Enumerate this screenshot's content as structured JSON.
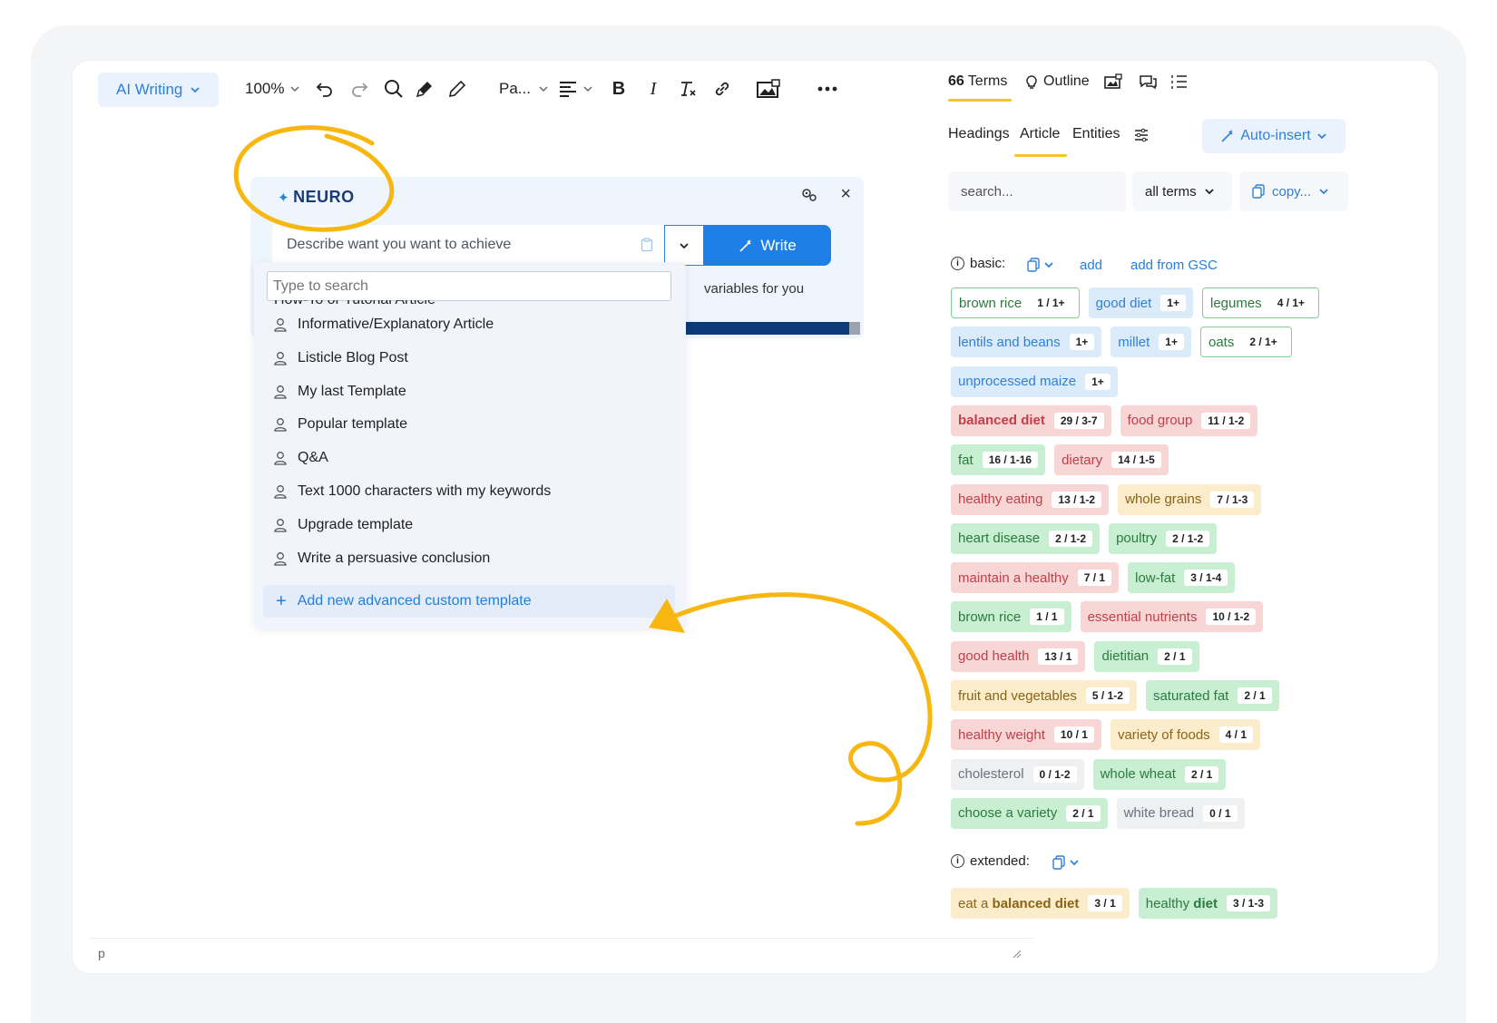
{
  "toolbar": {
    "ai_writing_label": "AI Writing",
    "zoom_label": "100%",
    "paragraph_label": "Pa..."
  },
  "editor": {
    "footer_tag": "p"
  },
  "neuro": {
    "logo_text": "NEURO",
    "prompt_placeholder": "Describe want you want to achieve",
    "write_label": "Write",
    "variables_text": "variables for you"
  },
  "dropdown": {
    "search_placeholder": "Type to search",
    "clipped_item": "How-To or Tutorial Article",
    "items": [
      "Informative/Explanatory Article",
      "Listicle Blog Post",
      "My last Template",
      "Popular template",
      "Q&A",
      "Text 1000 characters with my keywords",
      "Upgrade template",
      "Write a persuasive conclusion"
    ],
    "add_label": "Add new advanced custom template"
  },
  "right_panel": {
    "tabs": {
      "terms": "Terms",
      "outline": "Outline"
    },
    "sub_tabs": {
      "headings": "Headings",
      "article": "Article",
      "entities": "Entities"
    },
    "auto_insert_label": "Auto-insert",
    "search_placeholder": "search...",
    "filter_label": "all terms",
    "copy_label": "copy...",
    "basic_label": "basic:",
    "add_label": "add",
    "add_gsc_label": "add from GSC",
    "extended_label": "extended:"
  },
  "terms": [
    [
      {
        "text": "brown rice",
        "count": "1 / 1+",
        "style": "green-o"
      },
      {
        "text": "good diet",
        "count": "1+",
        "style": "blue"
      },
      {
        "text": "legumes",
        "count": "4 / 1+",
        "style": "green-o"
      }
    ],
    [
      {
        "text": "lentils and beans",
        "count": "1+",
        "style": "blue"
      },
      {
        "text": "millet",
        "count": "1+",
        "style": "blue"
      },
      {
        "text": "oats",
        "count": "2 / 1+",
        "style": "green-o"
      }
    ],
    [
      {
        "text": "unprocessed maize",
        "count": "1+",
        "style": "blue"
      }
    ],
    [
      {
        "text": "balanced diet",
        "count": "29 / 3-7",
        "style": "red-b"
      },
      {
        "text": "food group",
        "count": "11 / 1-2",
        "style": "red"
      }
    ],
    [
      {
        "text": "fat",
        "count": "16 / 1-16",
        "style": "green"
      },
      {
        "text": "dietary",
        "count": "14 / 1-5",
        "style": "red"
      }
    ],
    [
      {
        "text": "healthy eating",
        "count": "13 / 1-2",
        "style": "red"
      },
      {
        "text": "whole grains",
        "count": "7 / 1-3",
        "style": "yellow"
      }
    ],
    [
      {
        "text": "heart disease",
        "count": "2 / 1-2",
        "style": "green"
      },
      {
        "text": "poultry",
        "count": "2 / 1-2",
        "style": "green"
      }
    ],
    [
      {
        "text": "maintain a healthy",
        "count": "7 / 1",
        "style": "red"
      },
      {
        "text": "low-fat",
        "count": "3 / 1-4",
        "style": "green"
      }
    ],
    [
      {
        "text": "brown rice",
        "count": "1 / 1",
        "style": "green"
      },
      {
        "text": "essential nutrients",
        "count": "10 / 1-2",
        "style": "red"
      }
    ],
    [
      {
        "text": "good health",
        "count": "13 / 1",
        "style": "red"
      },
      {
        "text": "dietitian",
        "count": "2 / 1",
        "style": "green"
      }
    ],
    [
      {
        "text": "fruit and vegetables",
        "count": "5 / 1-2",
        "style": "yellow"
      },
      {
        "text": "saturated fat",
        "count": "2 / 1",
        "style": "green"
      }
    ],
    [
      {
        "text": "healthy weight",
        "count": "10 / 1",
        "style": "red"
      },
      {
        "text": "variety of foods",
        "count": "4 / 1",
        "style": "yellow"
      }
    ],
    [
      {
        "text": "cholesterol",
        "count": "0 / 1-2",
        "style": "gray"
      },
      {
        "text": "whole wheat",
        "count": "2 / 1",
        "style": "green"
      }
    ],
    [
      {
        "text": "choose a variety",
        "count": "2 / 1",
        "style": "green"
      },
      {
        "text": "white bread",
        "count": "0 / 1",
        "style": "gray"
      }
    ]
  ],
  "extended_terms": [
    {
      "text_pre": "eat a ",
      "text_bold": "balanced diet",
      "count": "3 / 1",
      "style": "yellow"
    },
    {
      "text_pre": "healthy ",
      "text_bold": "diet",
      "count": "3 / 1-3",
      "style": "green"
    }
  ],
  "colors": {
    "accent": "#1e7fe6",
    "highlight": "#f4c430",
    "progress": "#0d3a78"
  }
}
